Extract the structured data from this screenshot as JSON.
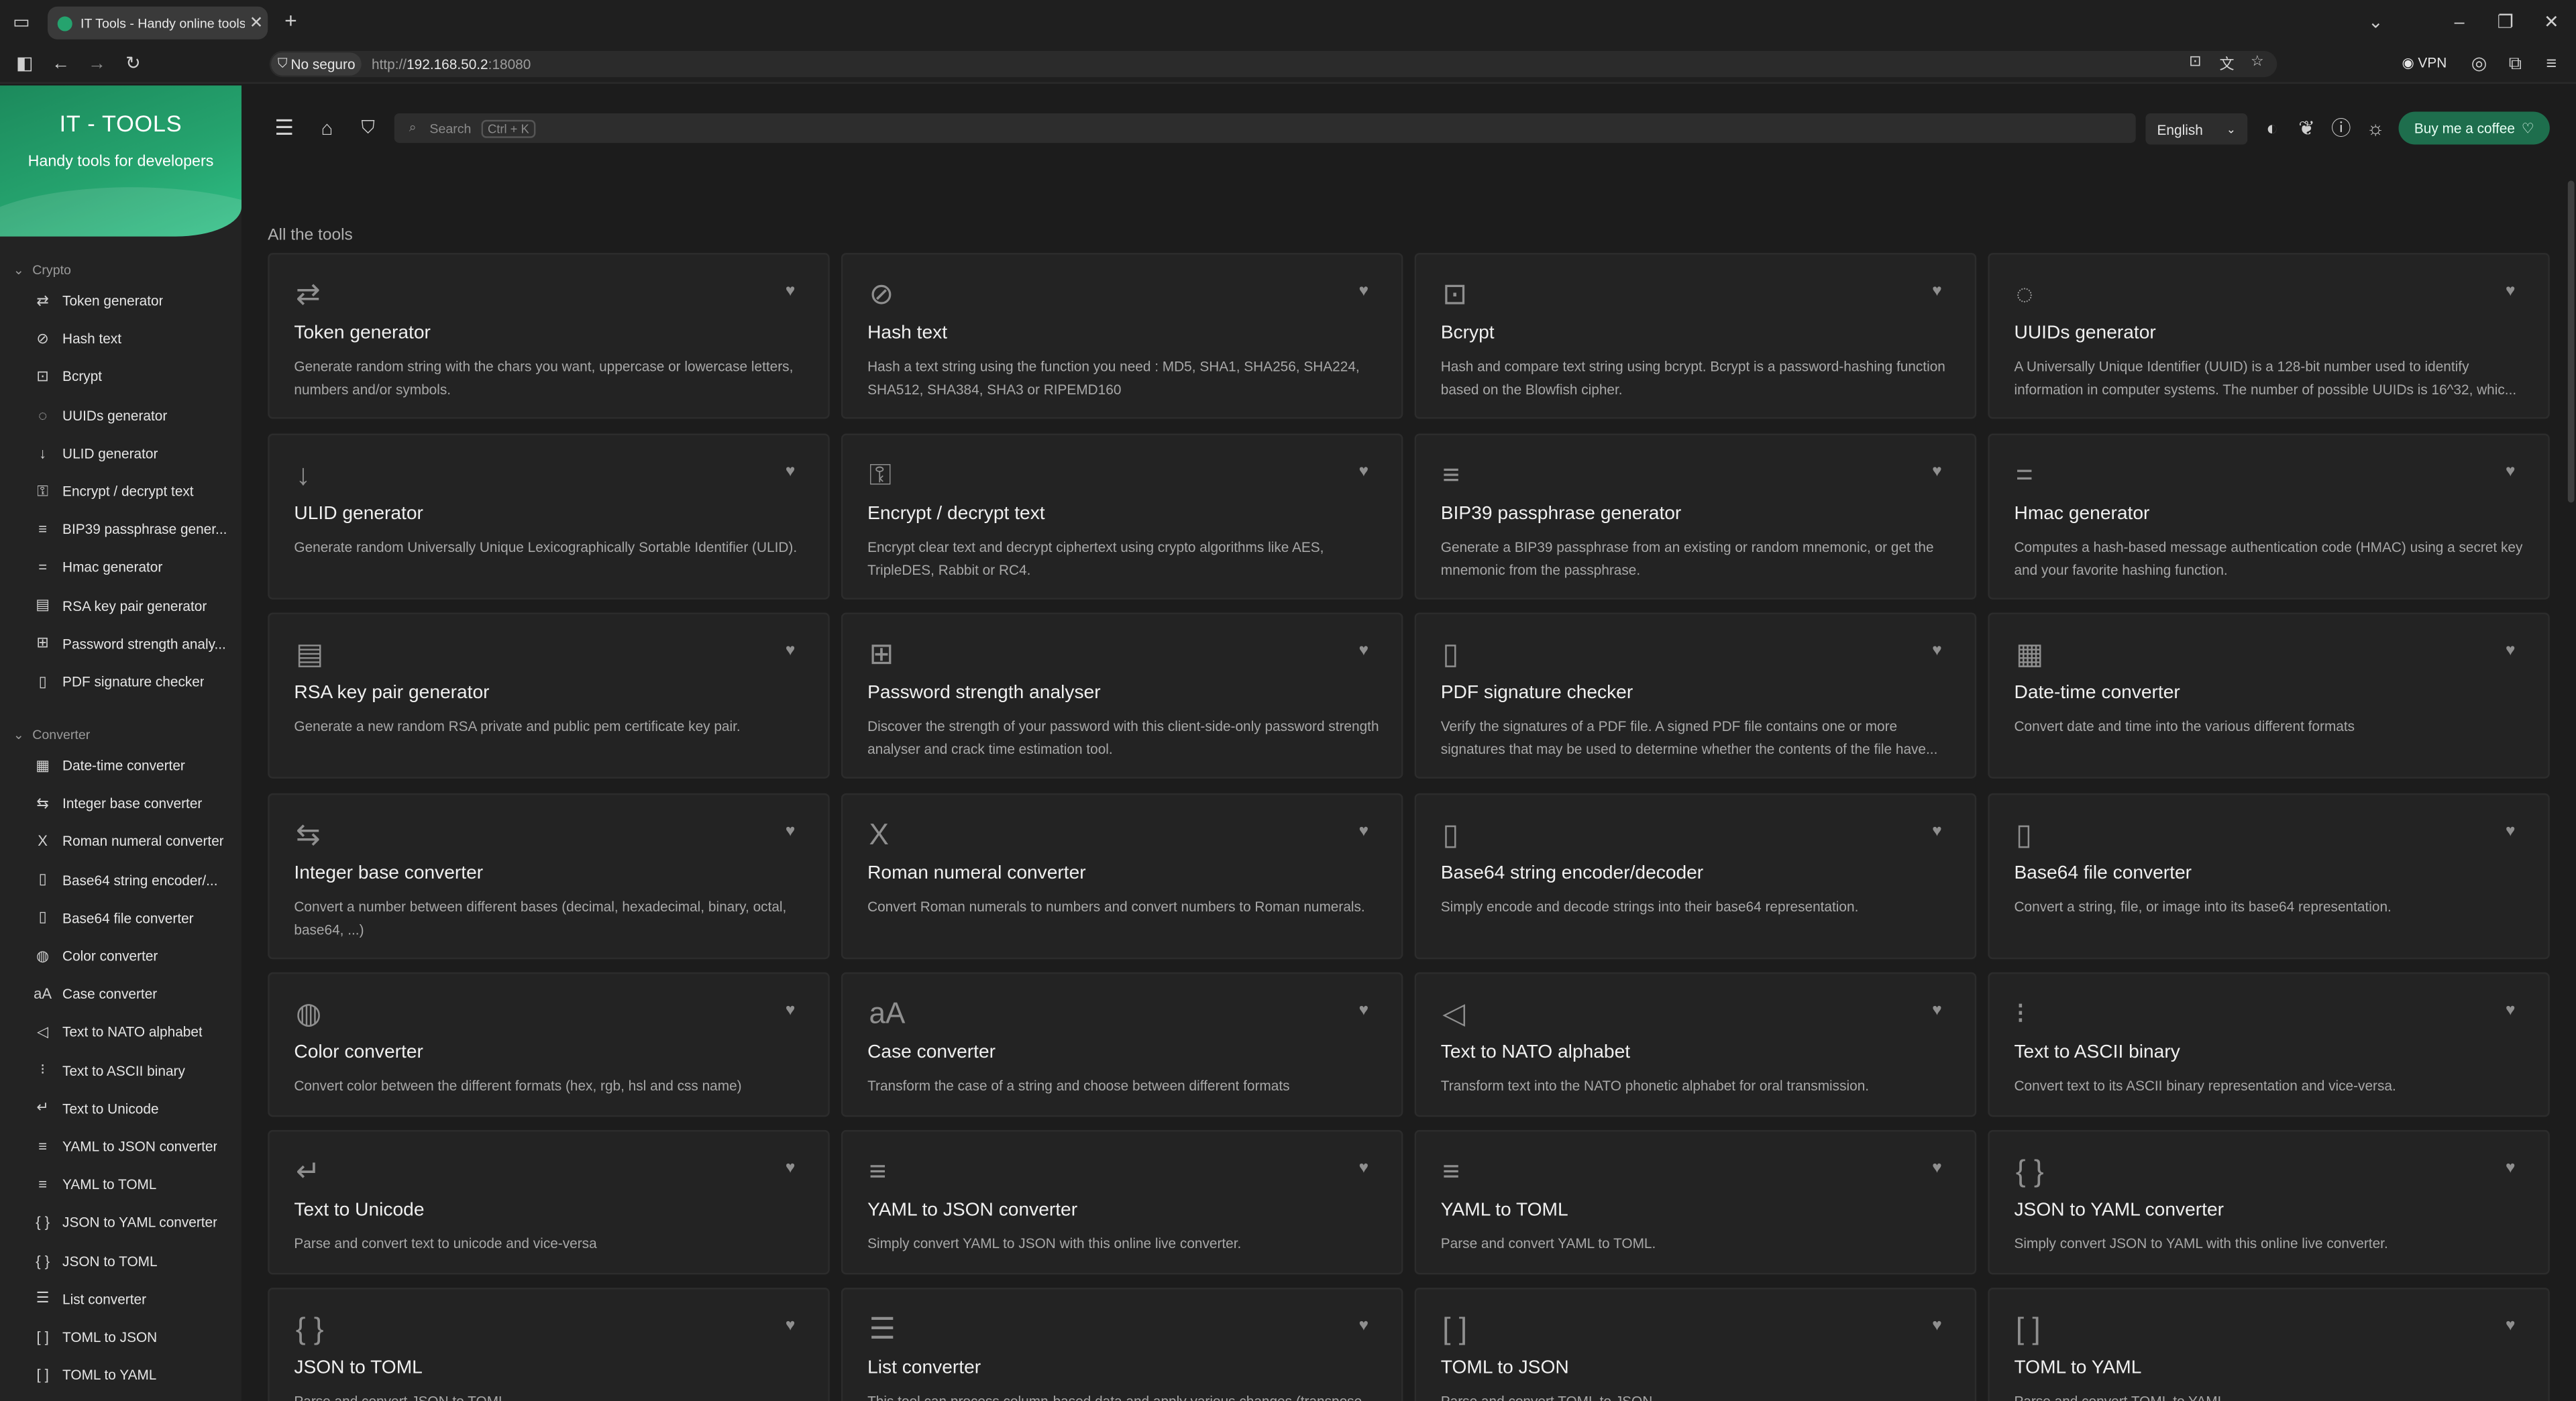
{
  "browser": {
    "tab_title": "IT Tools - Handy online tools for developers",
    "new_tab_glyph": "+",
    "url_security": "No seguro",
    "url_prefix": "http://",
    "url_host": "192.168.50.2",
    "url_port": ":18080",
    "vpn_label": "VPN"
  },
  "app": {
    "title": "IT - TOOLS",
    "subtitle": "Handy tools for developers",
    "search_placeholder": "Search",
    "search_shortcut": "Ctrl + K",
    "language": "English",
    "coffee_label": "Buy me a coffee",
    "all_tools_heading": "All the tools",
    "accent_color": "#25a36e"
  },
  "sidebar": {
    "categories": [
      {
        "label": "Crypto",
        "items": [
          {
            "label": "Token generator",
            "icon": "shuffle-icon"
          },
          {
            "label": "Hash text",
            "icon": "eye-off-icon"
          },
          {
            "label": "Bcrypt",
            "icon": "lock-square-icon"
          },
          {
            "label": "UUIDs generator",
            "icon": "fingerprint-icon"
          },
          {
            "label": "ULID generator",
            "icon": "sort-numbers-icon"
          },
          {
            "label": "Encrypt / decrypt text",
            "icon": "lock-icon"
          },
          {
            "label": "BIP39 passphrase gener...",
            "icon": "lines-icon"
          },
          {
            "label": "Hmac generator",
            "icon": "short-lines-icon"
          },
          {
            "label": "RSA key pair generator",
            "icon": "certificate-icon"
          },
          {
            "label": "Password strength analy...",
            "icon": "password-icon"
          },
          {
            "label": "PDF signature checker",
            "icon": "file-cert-icon"
          }
        ]
      },
      {
        "label": "Converter",
        "items": [
          {
            "label": "Date-time converter",
            "icon": "calendar-icon"
          },
          {
            "label": "Integer base converter",
            "icon": "arrows-icon"
          },
          {
            "label": "Roman numeral converter",
            "icon": "roman-x-icon"
          },
          {
            "label": "Base64 string encoder/...",
            "icon": "file-digit-icon"
          },
          {
            "label": "Base64 file converter",
            "icon": "file-digit-icon"
          },
          {
            "label": "Color converter",
            "icon": "palette-icon"
          },
          {
            "label": "Case converter",
            "icon": "letter-case-icon"
          },
          {
            "label": "Text to NATO alphabet",
            "icon": "speakerphone-icon"
          },
          {
            "label": "Text to ASCII binary",
            "icon": "binary-icon"
          },
          {
            "label": "Text to Unicode",
            "icon": "text-wrap-icon"
          },
          {
            "label": "YAML to JSON converter",
            "icon": "lines-icon"
          },
          {
            "label": "YAML to TOML",
            "icon": "lines-icon"
          },
          {
            "label": "JSON to YAML converter",
            "icon": "braces-icon"
          },
          {
            "label": "JSON to TOML",
            "icon": "braces-icon"
          },
          {
            "label": "List converter",
            "icon": "list-icon"
          },
          {
            "label": "TOML to JSON",
            "icon": "brackets-icon"
          },
          {
            "label": "TOML to YAML",
            "icon": "brackets-icon"
          }
        ]
      }
    ]
  },
  "tools": [
    {
      "title": "Token generator",
      "desc": "Generate random string with the chars you want, uppercase or lowercase letters, numbers and/or symbols.",
      "icon": "shuffle-icon"
    },
    {
      "title": "Hash text",
      "desc": "Hash a text string using the function you need : MD5, SHA1, SHA256, SHA224, SHA512, SHA384, SHA3 or RIPEMD160",
      "icon": "eye-off-icon"
    },
    {
      "title": "Bcrypt",
      "desc": "Hash and compare text string using bcrypt. Bcrypt is a password-hashing function based on the Blowfish cipher.",
      "icon": "lock-square-icon"
    },
    {
      "title": "UUIDs generator",
      "desc": "A Universally Unique Identifier (UUID) is a 128-bit number used to identify information in computer systems. The number of possible UUIDs is 16^32, whic...",
      "icon": "fingerprint-icon"
    },
    {
      "title": "ULID generator",
      "desc": "Generate random Universally Unique Lexicographically Sortable Identifier (ULID).",
      "icon": "sort-numbers-icon"
    },
    {
      "title": "Encrypt / decrypt text",
      "desc": "Encrypt clear text and decrypt ciphertext using crypto algorithms like AES, TripleDES, Rabbit or RC4.",
      "icon": "lock-icon"
    },
    {
      "title": "BIP39 passphrase generator",
      "desc": "Generate a BIP39 passphrase from an existing or random mnemonic, or get the mnemonic from the passphrase.",
      "icon": "lines-icon"
    },
    {
      "title": "Hmac generator",
      "desc": "Computes a hash-based message authentication code (HMAC) using a secret key and your favorite hashing function.",
      "icon": "short-lines-icon"
    },
    {
      "title": "RSA key pair generator",
      "desc": "Generate a new random RSA private and public pem certificate key pair.",
      "icon": "certificate-icon"
    },
    {
      "title": "Password strength analyser",
      "desc": "Discover the strength of your password with this client-side-only password strength analyser and crack time estimation tool.",
      "icon": "password-icon"
    },
    {
      "title": "PDF signature checker",
      "desc": "Verify the signatures of a PDF file. A signed PDF file contains one or more signatures that may be used to determine whether the contents of the file have...",
      "icon": "file-cert-icon"
    },
    {
      "title": "Date-time converter",
      "desc": "Convert date and time into the various different formats",
      "icon": "calendar-icon"
    },
    {
      "title": "Integer base converter",
      "desc": "Convert a number between different bases (decimal, hexadecimal, binary, octal, base64, ...)",
      "icon": "arrows-icon"
    },
    {
      "title": "Roman numeral converter",
      "desc": "Convert Roman numerals to numbers and convert numbers to Roman numerals.",
      "icon": "roman-x-icon"
    },
    {
      "title": "Base64 string encoder/decoder",
      "desc": "Simply encode and decode strings into their base64 representation.",
      "icon": "file-digit-icon"
    },
    {
      "title": "Base64 file converter",
      "desc": "Convert a string, file, or image into its base64 representation.",
      "icon": "file-digit-icon"
    },
    {
      "title": "Color converter",
      "desc": "Convert color between the different formats (hex, rgb, hsl and css name)",
      "icon": "palette-icon"
    },
    {
      "title": "Case converter",
      "desc": "Transform the case of a string and choose between different formats",
      "icon": "letter-case-icon"
    },
    {
      "title": "Text to NATO alphabet",
      "desc": "Transform text into the NATO phonetic alphabet for oral transmission.",
      "icon": "speakerphone-icon"
    },
    {
      "title": "Text to ASCII binary",
      "desc": "Convert text to its ASCII binary representation and vice-versa.",
      "icon": "binary-icon"
    },
    {
      "title": "Text to Unicode",
      "desc": "Parse and convert text to unicode and vice-versa",
      "icon": "text-wrap-icon"
    },
    {
      "title": "YAML to JSON converter",
      "desc": "Simply convert YAML to JSON with this online live converter.",
      "icon": "lines-icon"
    },
    {
      "title": "YAML to TOML",
      "desc": "Parse and convert YAML to TOML.",
      "icon": "lines-icon"
    },
    {
      "title": "JSON to YAML converter",
      "desc": "Simply convert JSON to YAML with this online live converter.",
      "icon": "braces-icon"
    },
    {
      "title": "JSON to TOML",
      "desc": "Parse and convert JSON to TOML.",
      "icon": "braces-icon"
    },
    {
      "title": "List converter",
      "desc": "This tool can process column-based data and apply various changes (transpose...",
      "icon": "list-icon"
    },
    {
      "title": "TOML to JSON",
      "desc": "Parse and convert TOML to JSON.",
      "icon": "brackets-icon"
    },
    {
      "title": "TOML to YAML",
      "desc": "Parse and convert TOML to YAML.",
      "icon": "brackets-icon"
    }
  ]
}
